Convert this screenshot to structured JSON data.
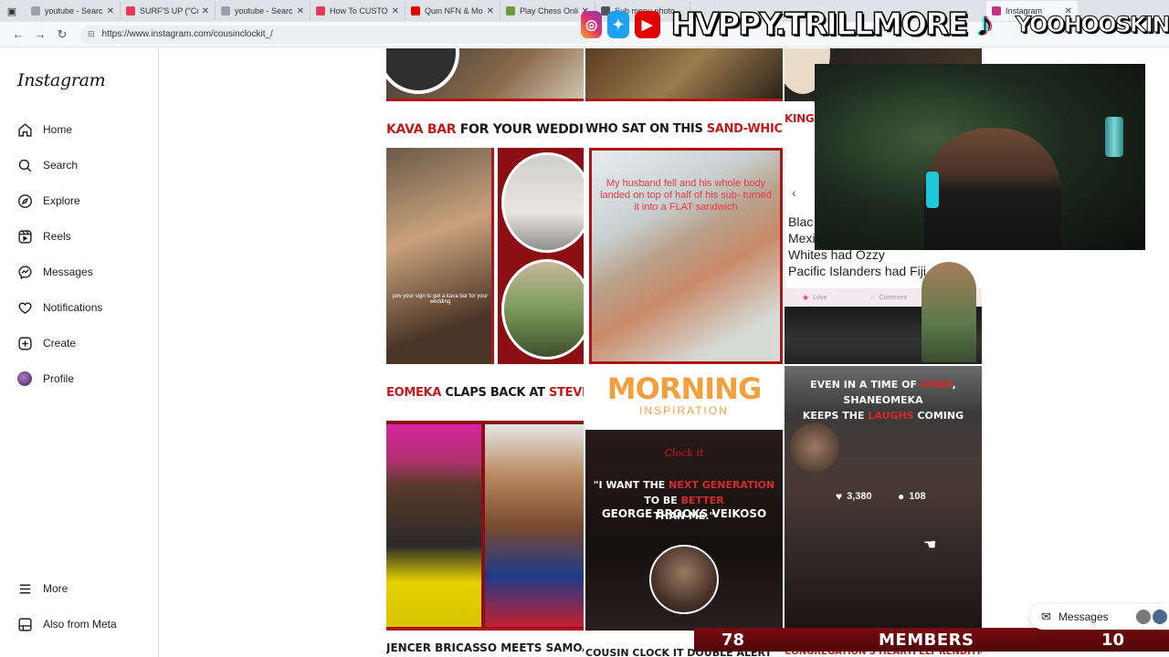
{
  "browser": {
    "tabs": [
      {
        "title": "youtube - Search",
        "color": "#9aa0a6"
      },
      {
        "title": "SURF'S UP (\"Cod",
        "color": "#e33d55"
      },
      {
        "title": "youtube - Search",
        "color": "#9aa0a6"
      },
      {
        "title": "How To CUSTOM",
        "color": "#e33d55"
      },
      {
        "title": "Quin NFN & Mo",
        "color": "#e00000"
      },
      {
        "title": "Play Chess Onlin",
        "color": "#6a9c3b"
      },
      {
        "title": "Sub menu photo",
        "color": "#555555"
      },
      {
        "title": "Instagram",
        "color": "#c13584"
      }
    ],
    "url": "https://www.instagram.com/cousinclockit_/"
  },
  "sidebar": {
    "logo": "Instagram",
    "items": [
      {
        "label": "Home",
        "icon": "home-icon"
      },
      {
        "label": "Search",
        "icon": "search-icon"
      },
      {
        "label": "Explore",
        "icon": "compass-icon"
      },
      {
        "label": "Reels",
        "icon": "reels-icon"
      },
      {
        "label": "Messages",
        "icon": "messenger-icon"
      },
      {
        "label": "Notifications",
        "icon": "heart-icon"
      },
      {
        "label": "Create",
        "icon": "plus-square-icon"
      },
      {
        "label": "Profile",
        "icon": "avatar"
      }
    ],
    "bottom": [
      {
        "label": "More",
        "icon": "menu-icon"
      },
      {
        "label": "Also from Meta",
        "icon": "meta-icon"
      }
    ]
  },
  "feed": {
    "posts": [
      {
        "title_pre": "KAVA BAR",
        "title_post": " FOR YOUR WEDDING",
        "caption": "pov your sign to get a kava bar for your wedding"
      },
      {
        "title_pre": "WHO SAT ON THIS ",
        "title_red": "SAND-WHICH",
        "title_post": " ? ",
        "caption": "My husband fell and his whole body landed on top of half of his sub- turned it into a FLAT sandwich"
      },
      {
        "title_pre": "KING S",
        "caption_lines": [
          "Blac",
          "Mexi",
          "Whites had Ozzy",
          "Pacific Islanders had Fiji"
        ],
        "love": "Love",
        "comment": "Comment"
      },
      {
        "title_pre": "EOMEKA",
        "title_post": " CLAPS BACK AT ",
        "title_red": "STEVEN SE"
      },
      {
        "title_main": "MORNING",
        "title_sub": "INSPIRATION",
        "logo": "Clock it",
        "quote_1": "\"I WANT THE ",
        "quote_red": "NEXT GENERATION",
        "quote_2": " TO BE ",
        "quote_red2": "BETTER",
        "quote_3": "THAN ME.\"",
        "author": "GEORGE BROOKS VEIKOSO"
      },
      {
        "title_line1": "EVEN IN A TIME OF ",
        "title_red1": "GRIEF",
        "title_mid": ", SHANEOMEKA",
        "title_line2": "KEEPS THE ",
        "title_red2": "LAUGHS",
        "title_end": " COMING",
        "likes": "3,380",
        "comments": "108"
      },
      {
        "bottom_left": "JENCER BRICASSO MEETS SAMOA'S VIL",
        "bottom_mid": "COUSIN CLOCK IT DOUBLE ALERT",
        "bottom_right": "CONGREGATION'S HEARTFELT RENDITION OF"
      }
    ]
  },
  "overlay": {
    "handle": "HVPPY.TRILLMORE",
    "handle_right": "YOOHOOSKIN",
    "members_left": "78",
    "members_label": "MEMBERS",
    "members_right": "10"
  },
  "messages_pill": "Messages"
}
